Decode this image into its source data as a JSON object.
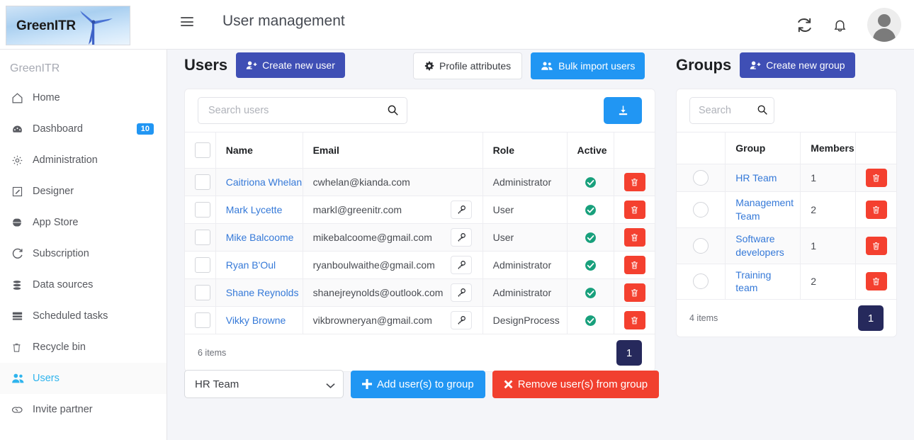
{
  "app": {
    "logo_text": "GreenITR",
    "sidebar_brand": "GreenITR",
    "page_title": "User management"
  },
  "topbar": {
    "menu_icon": "hamburger-icon",
    "refresh_icon": "refresh-icon",
    "notifications_icon": "bell-icon",
    "avatar_icon": "user-avatar-icon"
  },
  "sidebar": {
    "items": [
      {
        "label": "Home",
        "icon": "home-icon",
        "badge": "",
        "active": false
      },
      {
        "label": "Dashboard",
        "icon": "gauge-icon",
        "badge": "10",
        "active": false
      },
      {
        "label": "Administration",
        "icon": "gear-icon",
        "badge": "",
        "active": false
      },
      {
        "label": "Designer",
        "icon": "pencil-square-icon",
        "badge": "",
        "active": false
      },
      {
        "label": "App Store",
        "icon": "globe-icon",
        "badge": "",
        "active": false
      },
      {
        "label": "Subscription",
        "icon": "refresh-icon",
        "badge": "",
        "active": false
      },
      {
        "label": "Data sources",
        "icon": "database-icon",
        "badge": "",
        "active": false
      },
      {
        "label": "Scheduled tasks",
        "icon": "tasks-icon",
        "badge": "",
        "active": false
      },
      {
        "label": "Recycle bin",
        "icon": "trash-icon",
        "badge": "",
        "active": false
      },
      {
        "label": "Users",
        "icon": "users-icon",
        "badge": "",
        "active": true
      },
      {
        "label": "Invite partner",
        "icon": "handshake-icon",
        "badge": "",
        "active": false
      }
    ]
  },
  "users_panel": {
    "title": "Users",
    "create_button": "Create new user",
    "profile_attributes_button": "Profile attributes",
    "bulk_import_button": "Bulk import users",
    "search_placeholder": "Search users",
    "search_value": "",
    "export_icon": "download-icon",
    "columns": [
      "",
      "Name",
      "Email",
      "",
      "Role",
      "Active",
      ""
    ],
    "rows": [
      {
        "name": "Caitriona Whelan",
        "email": "cwhelan@kianda.com",
        "has_key": false,
        "role": "Administrator",
        "active": true
      },
      {
        "name": "Mark Lycette",
        "email": "markl@greenitr.com",
        "has_key": true,
        "role": "User",
        "active": true
      },
      {
        "name": "Mike Balcoome",
        "email": "mikebalcoome@gmail.com",
        "has_key": true,
        "role": "User",
        "active": true
      },
      {
        "name": "Ryan B'Oul",
        "email": "ryanboulwaithe@gmail.com",
        "has_key": true,
        "role": "Administrator",
        "active": true
      },
      {
        "name": "Shane Reynolds",
        "email": "shanejreynolds@outlook.com",
        "has_key": true,
        "role": "Administrator",
        "active": true
      },
      {
        "name": "Vikky Browne",
        "email": "vikbrowneryan@gmail.com",
        "has_key": true,
        "role": "DesignProcess",
        "active": true
      }
    ],
    "items_count": "6 items",
    "page_number": "1"
  },
  "groups_panel": {
    "title": "Groups",
    "create_button": "Create new group",
    "search_placeholder": "Search ",
    "search_value": "",
    "columns": [
      "",
      "Group",
      "Members",
      ""
    ],
    "rows": [
      {
        "group": "HR Team",
        "members": "1"
      },
      {
        "group": "Management Team",
        "members": "2"
      },
      {
        "group": "Software developers",
        "members": "1"
      },
      {
        "group": "Training team",
        "members": "2"
      }
    ],
    "items_count": "4 items",
    "page_number": "1"
  },
  "group_actions": {
    "selected_group": "HR Team",
    "options": [
      "HR Team",
      "Management Team",
      "Software developers",
      "Training team"
    ],
    "add_button": "Add user(s) to group",
    "remove_button": "Remove user(s) from group"
  },
  "colors": {
    "indigo": "#3f4fb5",
    "blue": "#2196f3",
    "red": "#f1402f",
    "green": "#18a07c",
    "navy": "#26295c",
    "link": "#3579d8",
    "active_nav": "#2fb4ed",
    "page_bg": "#f4f5f9"
  }
}
